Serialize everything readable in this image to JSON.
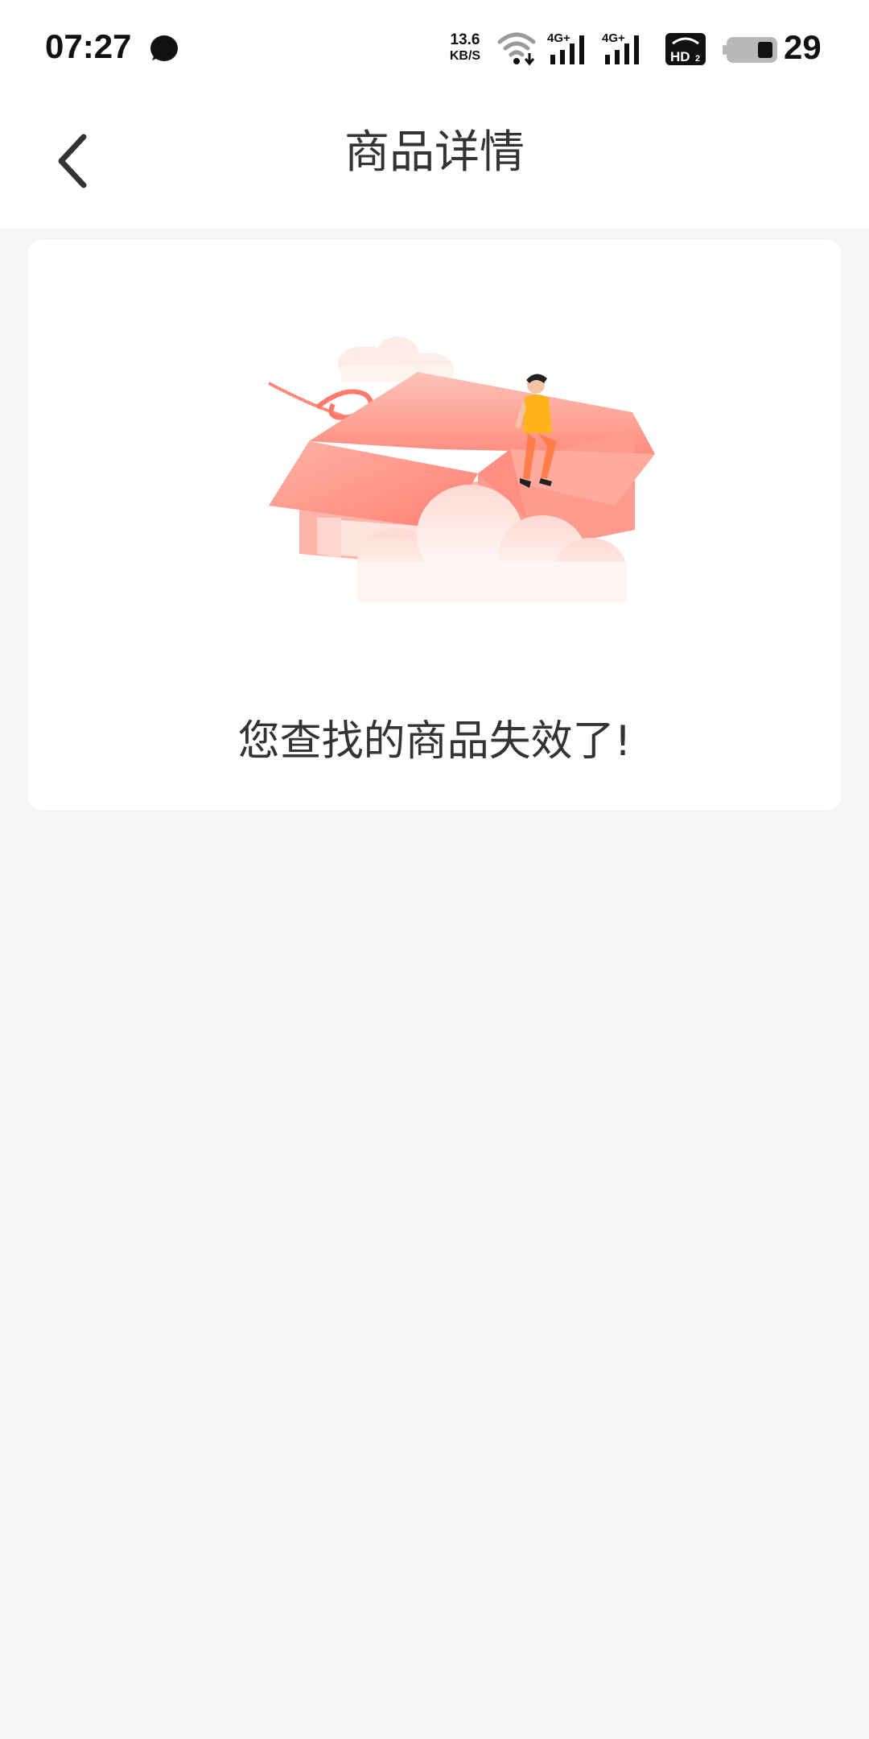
{
  "status_bar": {
    "time": "07:27",
    "net_speed_value": "13.6",
    "net_speed_unit": "KB/S",
    "battery_level": "29",
    "icons": [
      "chat-bubble-icon",
      "wifi-icon",
      "signal-4g-icon",
      "signal-4g-icon",
      "hd-icon",
      "battery-icon"
    ]
  },
  "nav": {
    "back_icon": "chevron-left-icon",
    "title": "商品详情"
  },
  "empty_state": {
    "illustration": "open-box-with-person-icon",
    "message": "您查找的商品失效了!"
  },
  "colors": {
    "background": "#f5f5f5",
    "card": "#ffffff",
    "text": "#333333",
    "accent": "#ff8a7a"
  }
}
